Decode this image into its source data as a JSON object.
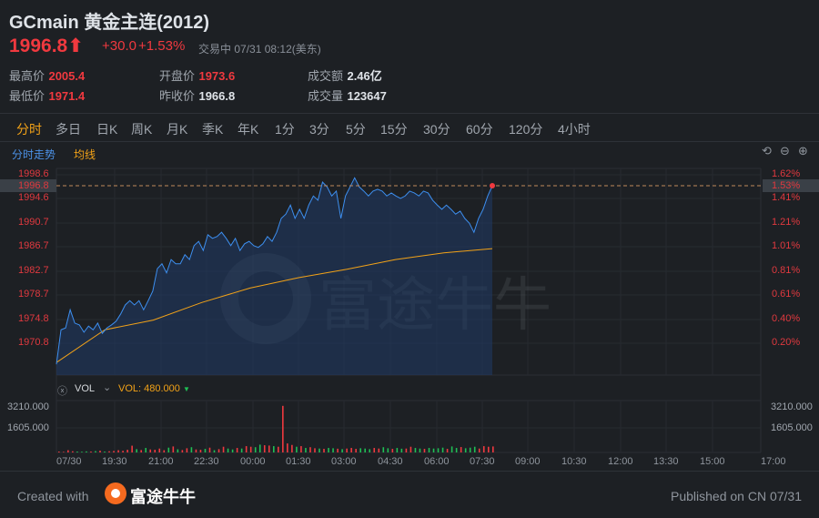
{
  "header": {
    "title": "GCmain 黄金主连(2012)",
    "price": "1996.8",
    "arrow": "⬆",
    "change": "+30.0",
    "change_pct": "+1.53%",
    "status": "交易中",
    "datetime": "07/31 08:12(美东)"
  },
  "stats": [
    {
      "label": "最高价",
      "value": "2005.4",
      "color": "red"
    },
    {
      "label": "最低价",
      "value": "1971.4",
      "color": "red"
    },
    {
      "label": "开盘价",
      "value": "1973.6",
      "color": "red"
    },
    {
      "label": "昨收价",
      "value": "1966.8",
      "color": "white"
    },
    {
      "label": "成交额",
      "value": "2.46亿",
      "color": "white"
    },
    {
      "label": "成交量",
      "value": "123647",
      "color": "white"
    }
  ],
  "tabs": [
    "分时",
    "多日",
    "日K",
    "周K",
    "月K",
    "季K",
    "年K",
    "1分",
    "3分",
    "5分",
    "15分",
    "30分",
    "60分",
    "120分",
    "4小时"
  ],
  "active_tab": "分时",
  "subbar": {
    "trend": "分时走势",
    "ma": "均线"
  },
  "icons": [
    "undo-icon",
    "zoom-out-icon",
    "zoom-in-icon"
  ],
  "price_axis": [
    "1998.6",
    "1994.6",
    "1990.7",
    "1986.7",
    "1982.7",
    "1978.7",
    "1974.8",
    "1970.8"
  ],
  "pct_axis": [
    "1.62%",
    "1.41%",
    "1.21%",
    "1.01%",
    "0.81%",
    "0.61%",
    "0.40%",
    "0.20%"
  ],
  "current": {
    "price": "1996.8",
    "pct": "1.53%"
  },
  "vol": {
    "name": "VOL",
    "value_label": "VOL: 480.000",
    "trend": "▼",
    "axis": [
      "3210.000",
      "1605.000"
    ]
  },
  "time_axis": [
    "07/30",
    "19:30",
    "21:00",
    "22:30",
    "00:00",
    "01:30",
    "03:00",
    "04:30",
    "06:00",
    "07:30",
    "09:00",
    "10:30",
    "12:00",
    "13:30",
    "15:00",
    "17:00"
  ],
  "watermark": "富途牛牛",
  "footer": {
    "created": "Created with",
    "brand": "富途牛牛",
    "published": "Published on CN 07/31"
  },
  "colors": {
    "up": "#f0393f",
    "down": "#1fbf55",
    "line": "#3d8ff0",
    "ma": "#f2a218",
    "accent": "#f2a218"
  },
  "chart_data": {
    "type": "line",
    "ylim": [
      1968.2,
      2000
    ],
    "prev_close": 1966.8,
    "current": 1996.8,
    "series": [
      {
        "name": "price",
        "values": [
          1967.3,
          1973.0,
          1973.3,
          1976.3,
          1974.1,
          1973.8,
          1972.6,
          1973.6,
          1973.0,
          1974.1,
          1972.4,
          1973.3,
          1973.8,
          1974.4,
          1975.6,
          1977.1,
          1977.8,
          1977.1,
          1977.8,
          1976.3,
          1977.8,
          1979.4,
          1983.1,
          1983.9,
          1982.4,
          1984.6,
          1983.9,
          1983.9,
          1985.4,
          1984.6,
          1986.9,
          1987.6,
          1986.1,
          1988.7,
          1988.1,
          1988.4,
          1989.1,
          1988.1,
          1986.9,
          1988.1,
          1986.1,
          1987.2,
          1987.6,
          1986.9,
          1986.6,
          1987.2,
          1988.4,
          1987.6,
          1989.1,
          1991.4,
          1992.1,
          1993.6,
          1991.4,
          1992.9,
          1991.4,
          1993.6,
          1995.1,
          1994.4,
          1997.4,
          1996.6,
          1995.1,
          1995.9,
          1991.4,
          1995.1,
          1996.6,
          1998.1,
          1996.6,
          1995.9,
          1995.1,
          1995.9,
          1996.2,
          1995.9,
          1995.1,
          1995.6,
          1995.1,
          1994.7,
          1995.1,
          1995.9,
          1995.6,
          1995.1,
          1995.9,
          1995.6,
          1994.4,
          1993.6,
          1992.9,
          1993.6,
          1992.9,
          1992.1,
          1992.6,
          1991.4,
          1990.6,
          1989.1,
          1991.4,
          1992.9,
          1995.1,
          1996.8
        ]
      },
      {
        "name": "均线",
        "values": [
          1967.6,
          1973.0,
          1974.6,
          1977.5,
          1979.9,
          1981.6,
          1983.0,
          1984.6,
          1985.7,
          1986.4
        ]
      }
    ],
    "volume": {
      "ylim": [
        0,
        3210
      ],
      "values": [
        60,
        40,
        150,
        80,
        60,
        50,
        70,
        60,
        90,
        120,
        60,
        80,
        100,
        150,
        110,
        180,
        450,
        220,
        160,
        300,
        200,
        180,
        260,
        150,
        320,
        400,
        210,
        160,
        280,
        350,
        200,
        180,
        240,
        320,
        150,
        220,
        380,
        260,
        200,
        300,
        260,
        420,
        380,
        350,
        520,
        480,
        460,
        420,
        380,
        3100,
        600,
        500,
        380,
        420,
        300,
        350,
        280,
        260,
        240,
        300,
        280,
        250,
        220,
        260,
        300,
        240,
        280,
        260,
        220,
        300,
        260,
        350,
        280,
        240,
        300,
        250,
        260,
        380,
        300,
        260,
        240,
        300,
        260,
        280,
        320,
        240,
        400,
        300,
        360,
        280,
        320,
        380,
        260,
        420,
        380,
        400
      ],
      "up_down": "mixed"
    }
  }
}
